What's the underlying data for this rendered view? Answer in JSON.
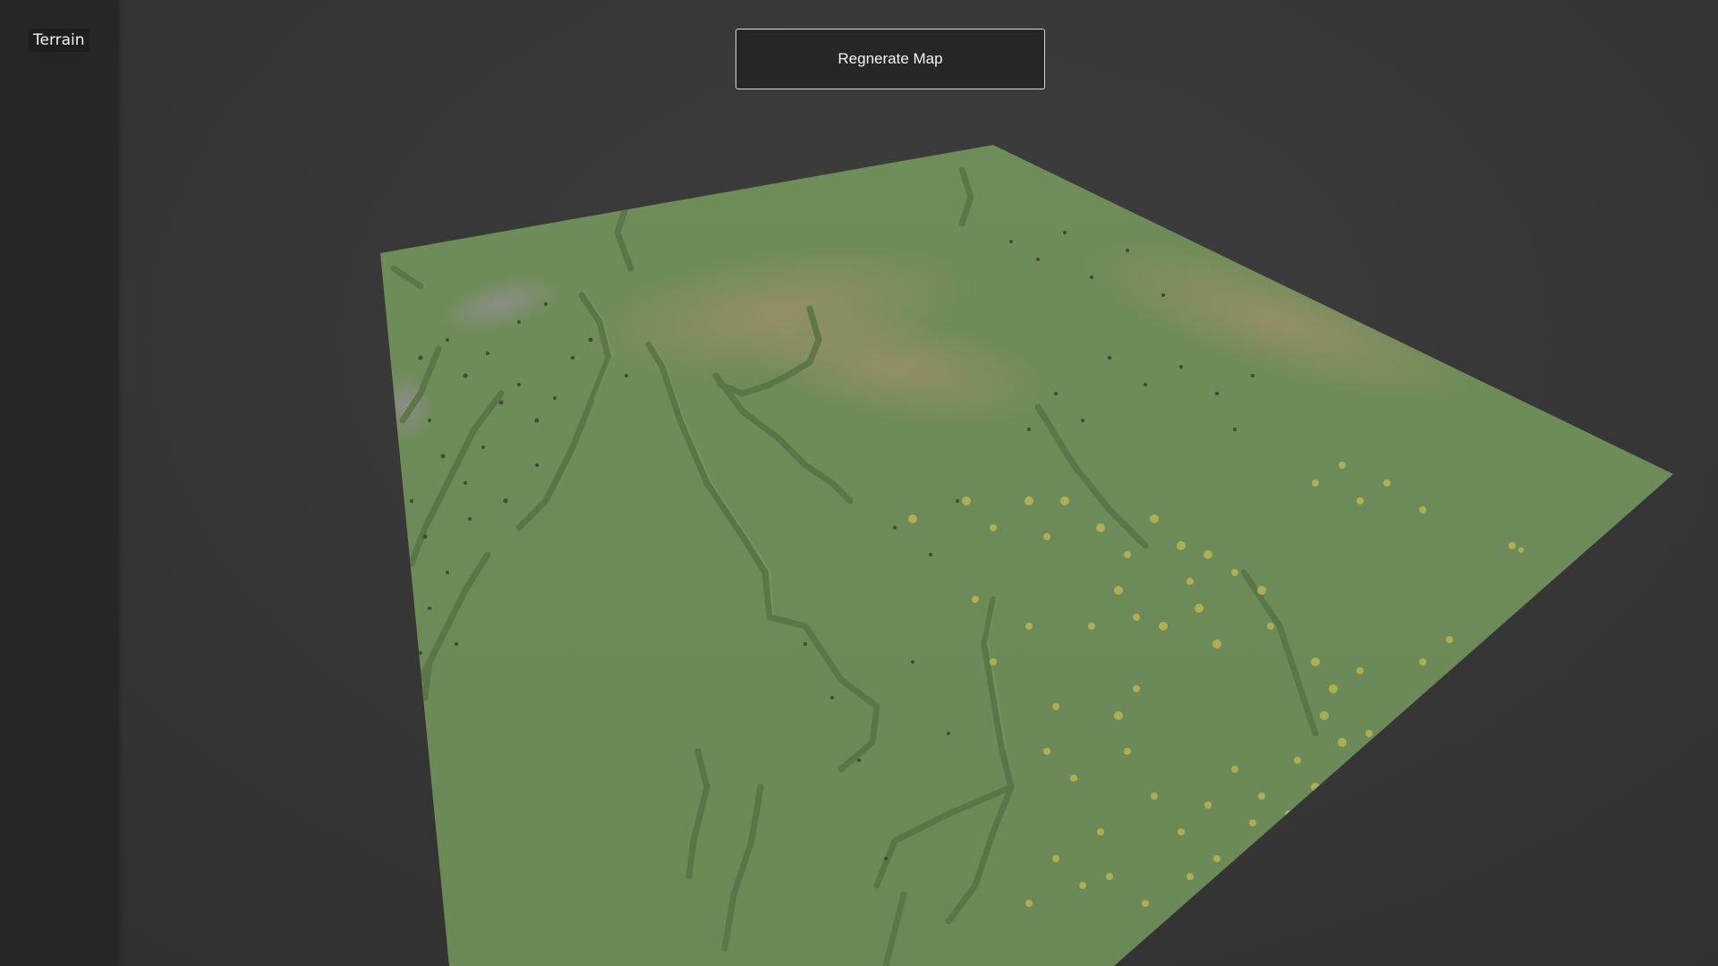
{
  "sidebar": {
    "title": "Terrain"
  },
  "toolbar": {
    "regenerate_label": "Regnerate Map"
  },
  "scene": {
    "terrain_icon": "terrain-mesh",
    "colors": {
      "grass": "#6e8c58",
      "grass_dark": "#5e7a4a",
      "dirt": "#9a8a66",
      "rock": "#8f8a88",
      "tree": "#b8b455",
      "tree_dark": "#3c4a2c"
    }
  }
}
